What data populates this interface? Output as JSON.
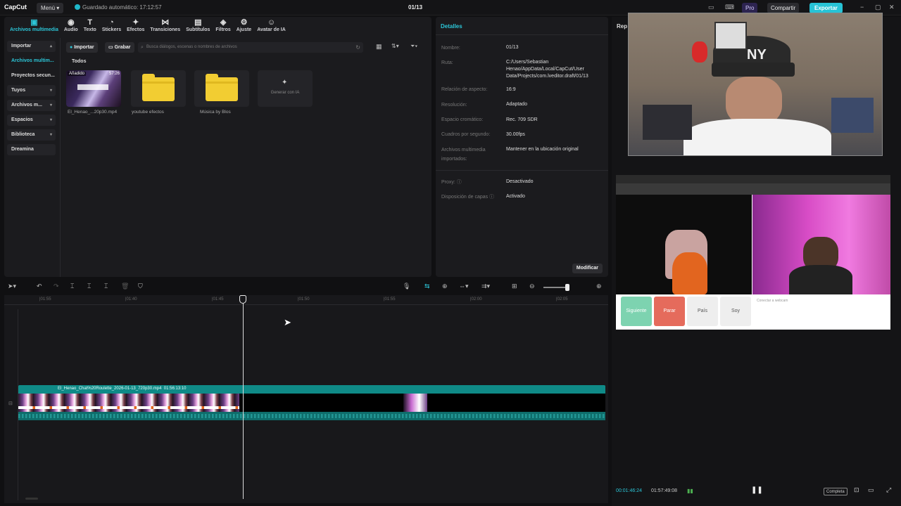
{
  "topbar": {
    "logo": "CapCut",
    "menu_label": "Menú ▾",
    "autosave_text": "Guardado automático: 17:12:57",
    "project_title": "01/13",
    "pro_label": "Pro",
    "share_label": "Compartir",
    "export_label": "Exportar",
    "win_controls": [
      "−",
      "▢",
      "✕"
    ]
  },
  "tools": [
    {
      "label": "Archivos multimedia",
      "icon": "▣",
      "active": true
    },
    {
      "label": "Audio",
      "icon": "◉"
    },
    {
      "label": "Texto",
      "icon": "T"
    },
    {
      "label": "Stickers",
      "icon": "◔"
    },
    {
      "label": "Efectos",
      "icon": "✦"
    },
    {
      "label": "Transiciones",
      "icon": "⋈"
    },
    {
      "label": "Subtítulos",
      "icon": "▤"
    },
    {
      "label": "Filtros",
      "icon": "◈"
    },
    {
      "label": "Ajuste",
      "icon": "⚙"
    },
    {
      "label": "Avatar de IA",
      "icon": "☺"
    }
  ],
  "sidebar": [
    {
      "label": "Importar",
      "box": true,
      "chev": "▴"
    },
    {
      "label": "Archivos multim...",
      "sel": true
    },
    {
      "label": "Proyectos secun...",
      "chev": ""
    },
    {
      "label": "Tuyos",
      "box": true,
      "chev": "▾"
    },
    {
      "label": "Archivos m...",
      "box": true,
      "chev": "▾"
    },
    {
      "label": "Espacios",
      "box": true,
      "chev": "▾"
    },
    {
      "label": "Biblioteca",
      "box": true,
      "chev": "▾"
    },
    {
      "label": "Dreamina",
      "box": true
    }
  ],
  "media_bar": {
    "import_label": "Importar",
    "record_label": "Grabar",
    "search_placeholder": "Busca diálogos, escenas o nombres de archivos"
  },
  "media": {
    "section_label": "Todos",
    "items": [
      {
        "label": "El_Henao_...20p30.mp4",
        "badge": "Añadido",
        "duration": "57:26",
        "kind": "video"
      },
      {
        "label": "youtube efectos",
        "kind": "folder"
      },
      {
        "label": "Música by Blos",
        "kind": "folder"
      },
      {
        "label": "Generar con IA",
        "kind": "generate"
      }
    ]
  },
  "details": {
    "title": "Detalles",
    "rows": [
      {
        "k": "Nombre:",
        "v": "01/13"
      },
      {
        "k": "Ruta:",
        "v": "C:/Users/Sebastian Henao/AppData/Local/CapCut/User Data/Projects/com.lveditor.draft/01/13"
      },
      {
        "k": "Relación de aspecto:",
        "v": "16:9"
      },
      {
        "k": "Resolución:",
        "v": "Adaptado"
      },
      {
        "k": "Espacio cromático:",
        "v": "Rec. 709 SDR"
      },
      {
        "k": "Cuadros por segundo:",
        "v": "30.00fps"
      },
      {
        "k": "Archivos multimedia importados:",
        "v": "Mantener en la ubicación original"
      },
      {
        "k": "Proxy: ⓘ",
        "v": "Desactivado"
      },
      {
        "k": "Disposición de capas ⓘ",
        "v": "Activado"
      }
    ],
    "modify_label": "Modificar"
  },
  "preview": {
    "title": "Rep",
    "current_time": "00:01:46:24",
    "total_time": "01:57:49:08",
    "full_label": "Completa",
    "screen_buttons": [
      "Siguiente",
      "Parar",
      "País",
      "Soy"
    ],
    "screen_note": "Conectar a webcam"
  },
  "timeline": {
    "ruler": [
      "|01:55",
      "|01:40",
      "|01:45",
      "|01:50",
      "|01:55",
      "|02:00",
      "|02:05"
    ],
    "clip_name": "El_Henao_Chat%20Roulette_2026-01-13_720p30.mp4",
    "clip_duration": "01:56:13:10"
  },
  "colors": {
    "accent": "#2cc6d8",
    "track": "#0f8a87",
    "export": "#27c3d6"
  }
}
